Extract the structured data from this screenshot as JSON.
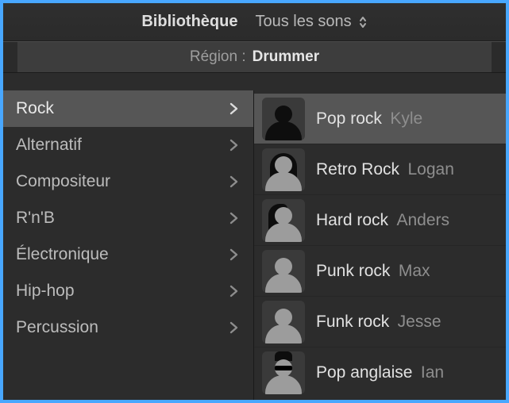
{
  "header": {
    "library": "Bibliothèque",
    "scope": "Tous les sons",
    "region_prefix": "Région :",
    "region_value": "Drummer"
  },
  "categories": [
    {
      "label": "Rock",
      "selected": true
    },
    {
      "label": "Alternatif",
      "selected": false
    },
    {
      "label": "Compositeur",
      "selected": false
    },
    {
      "label": "R'n'B",
      "selected": false
    },
    {
      "label": "Électronique",
      "selected": false
    },
    {
      "label": "Hip-hop",
      "selected": false
    },
    {
      "label": "Percussion",
      "selected": false
    }
  ],
  "drummers": [
    {
      "style": "Pop rock",
      "name": "Kyle",
      "avatar": "dark",
      "selected": true
    },
    {
      "style": "Retro Rock",
      "name": "Logan",
      "avatar": "longhair",
      "selected": false
    },
    {
      "style": "Hard rock",
      "name": "Anders",
      "avatar": "sidehair",
      "selected": false
    },
    {
      "style": "Punk rock",
      "name": "Max",
      "avatar": "plain",
      "selected": false
    },
    {
      "style": "Funk rock",
      "name": "Jesse",
      "avatar": "plain",
      "selected": false
    },
    {
      "style": "Pop anglaise",
      "name": "Ian",
      "avatar": "hatshade",
      "selected": false
    }
  ]
}
